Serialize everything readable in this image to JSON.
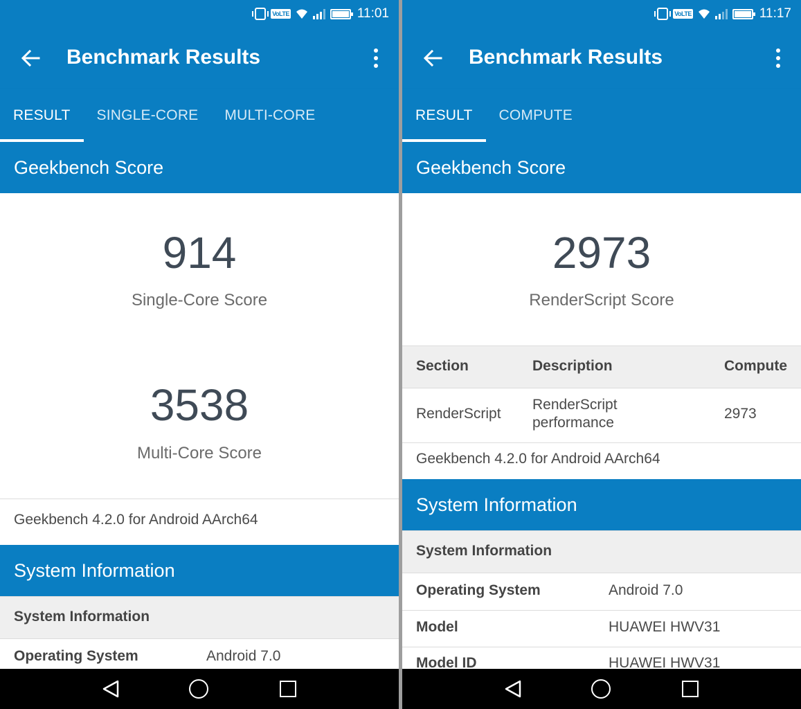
{
  "left": {
    "status": {
      "time": "11:01",
      "volte": "VoLTE"
    },
    "appbar": {
      "title": "Benchmark Results"
    },
    "tabs": [
      "RESULT",
      "SINGLE-CORE",
      "MULTI-CORE"
    ],
    "score_header": "Geekbench Score",
    "scores": [
      {
        "value": "914",
        "label": "Single-Core Score"
      },
      {
        "value": "3538",
        "label": "Multi-Core Score"
      }
    ],
    "version": "Geekbench 4.2.0 for Android AArch64",
    "sysinfo_header": "System Information",
    "sysinfo_subheader": "System Information",
    "sysinfo_rows": [
      {
        "label": "Operating System",
        "value": "Android 7.0"
      }
    ]
  },
  "right": {
    "status": {
      "time": "11:17",
      "volte": "VoLTE"
    },
    "appbar": {
      "title": "Benchmark Results"
    },
    "tabs": [
      "RESULT",
      "COMPUTE"
    ],
    "score_header": "Geekbench Score",
    "score": {
      "value": "2973",
      "label": "RenderScript Score"
    },
    "table": {
      "headers": [
        "Section",
        "Description",
        "Compute"
      ],
      "row": {
        "section": "RenderScript",
        "description_line1": "RenderScript",
        "description_line2": "performance",
        "compute": "2973"
      }
    },
    "version": "Geekbench 4.2.0 for Android AArch64",
    "sysinfo_header": "System Information",
    "sysinfo_subheader": "System Information",
    "sysinfo_rows": [
      {
        "label": "Operating System",
        "value": "Android 7.0"
      },
      {
        "label": "Model",
        "value": "HUAWEI HWV31"
      },
      {
        "label": "Model ID",
        "value": "HUAWEI HWV31"
      }
    ]
  },
  "colors": {
    "primary": "#0a7ec2",
    "text_dark": "#3f4a56",
    "row_gray": "#efefef"
  }
}
